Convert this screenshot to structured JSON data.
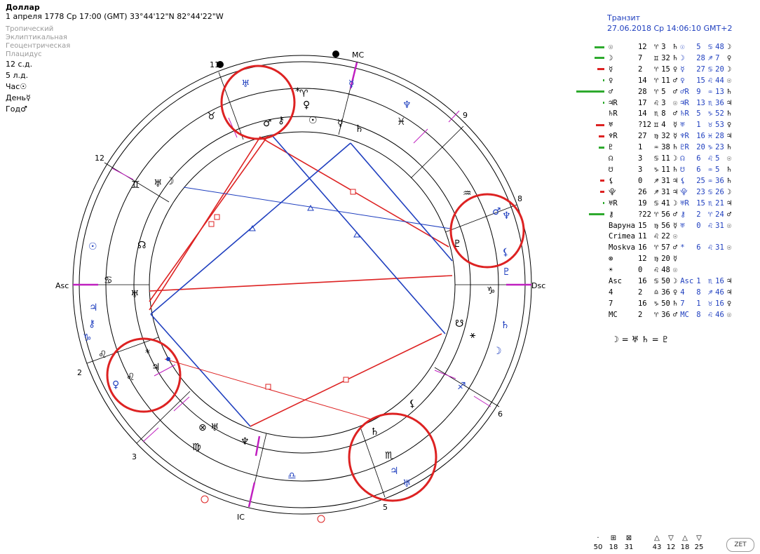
{
  "header": {
    "title": "Доллар",
    "subtitle": "1 апреля 1778  Ср  17:00 (GMT) 33°44'12\"N  82°44'22\"W",
    "settings": [
      "Тропический",
      "Эклиптикальная",
      "Геоцентрическая",
      "Плацидус"
    ],
    "day_info": [
      "12 с.д.",
      "5 л.д.",
      "Час☉",
      "День☿",
      "Год♂"
    ]
  },
  "transit": {
    "title": "Транзит",
    "datetime": "27.06.2018 Ср 14:06:10 GMT+2"
  },
  "wheel_labels": {
    "mc": "MC",
    "ic": "IC",
    "asc": "Asc",
    "dsc": "Dsc",
    "houses": [
      "11",
      "12",
      "2",
      "3",
      "5",
      "6",
      "8",
      "9"
    ]
  },
  "aspect_rows": [
    {
      "bar": "#2eaa2e",
      "w": 14,
      "n": "☉",
      "deg": "12",
      "sign": "♈",
      "min": "3",
      "r": "♄",
      "tn": "☉",
      "tdeg": "5",
      "tsign": "♋",
      "tmin": "48",
      "tr": "☽"
    },
    {
      "bar": "#2eaa2e",
      "w": 14,
      "n": "☽",
      "deg": "7",
      "sign": "♊",
      "min": "32",
      "r": "♄",
      "tn": "☽",
      "tdeg": "28",
      "tsign": "♐",
      "tmin": "7",
      "tr": "♀"
    },
    {
      "bar": "#dd2222",
      "w": 10,
      "n": "☿",
      "deg": "2",
      "sign": "♈",
      "min": "15",
      "r": "♀",
      "tn": "☿",
      "tdeg": "27",
      "tsign": "♋",
      "tmin": "20",
      "tr": "☽"
    },
    {
      "bar": "#2eaa2e",
      "w": 2,
      "n": "♀",
      "deg": "14",
      "sign": "♈",
      "min": "11",
      "r": "♂",
      "tn": "♀",
      "tdeg": "15",
      "tsign": "♌",
      "tmin": "44",
      "tr": "☉"
    },
    {
      "bar": "#2eaa2e",
      "w": 40,
      "n": "♂",
      "deg": "28",
      "sign": "♈",
      "min": "5",
      "r": "♂",
      "tn": "♂R",
      "tdeg": "9",
      "tsign": "♒",
      "tmin": "13",
      "tr": "♄"
    },
    {
      "bar": "#2eaa2e",
      "w": 2,
      "n": "♃R",
      "deg": "17",
      "sign": "♌",
      "min": "3",
      "r": "☉",
      "tn": "♃R",
      "tdeg": "13",
      "tsign": "♏",
      "tmin": "36",
      "tr": "♃"
    },
    {
      "bar": "",
      "w": 0,
      "n": "♄R",
      "deg": "14",
      "sign": "♏",
      "min": "8",
      "r": "♂",
      "tn": "♄R",
      "tdeg": "5",
      "tsign": "♑",
      "tmin": "52",
      "tr": "♄"
    },
    {
      "bar": "#dd2222",
      "w": 12,
      "n": "♅",
      "deg": "?12",
      "sign": "♊",
      "min": "4",
      "r": "☿",
      "tn": "♅",
      "tdeg": "1",
      "tsign": "♉",
      "tmin": "53",
      "tr": "♀"
    },
    {
      "bar": "#dd2222",
      "w": 8,
      "n": "♆R",
      "deg": "27",
      "sign": "♍",
      "min": "32",
      "r": "☿",
      "tn": "♆R",
      "tdeg": "16",
      "tsign": "♓",
      "tmin": "28",
      "tr": "♃"
    },
    {
      "bar": "#2eaa2e",
      "w": 8,
      "n": "♇",
      "deg": "1",
      "sign": "♒",
      "min": "38",
      "r": "♄",
      "tn": "♇R",
      "tdeg": "20",
      "tsign": "♑",
      "tmin": "23",
      "tr": "♄"
    },
    {
      "bar": "",
      "w": 0,
      "n": "☊",
      "deg": "3",
      "sign": "♋",
      "min": "11",
      "r": "☽",
      "tn": "☊",
      "tdeg": "6",
      "tsign": "♌",
      "tmin": "5",
      "tr": "☉"
    },
    {
      "bar": "",
      "w": 0,
      "n": "☋",
      "deg": "3",
      "sign": "♑",
      "min": "11",
      "r": "♄",
      "tn": "☋",
      "tdeg": "6",
      "tsign": "♒",
      "tmin": "5",
      "tr": "♄"
    },
    {
      "bar": "#dd2222",
      "w": 6,
      "n": "⚸",
      "deg": "0",
      "sign": "♐",
      "min": "31",
      "r": "♃",
      "tn": "⚸",
      "tdeg": "25",
      "tsign": "♒",
      "tmin": "36",
      "tr": "♄"
    },
    {
      "bar": "#dd2222",
      "w": 6,
      "n": "⯓",
      "deg": "26",
      "sign": "♐",
      "min": "31",
      "r": "♃",
      "tn": "⯓",
      "tdeg": "23",
      "tsign": "♋",
      "tmin": "26",
      "tr": "☽"
    },
    {
      "bar": "#2eaa2e",
      "w": 2,
      "n": "♅R",
      "deg": "19",
      "sign": "♋",
      "min": "41",
      "r": "☽",
      "tn": "♅R",
      "tdeg": "15",
      "tsign": "♏",
      "tmin": "21",
      "tr": "♃"
    },
    {
      "bar": "#2eaa2e",
      "w": 22,
      "n": "⚷",
      "deg": "?22",
      "sign": "♈",
      "min": "56",
      "r": "♂",
      "tn": "⚷",
      "tdeg": "2",
      "tsign": "♈",
      "tmin": "24",
      "tr": "♂"
    },
    {
      "bar": "",
      "w": 0,
      "n": "Варуна",
      "deg": "15",
      "sign": "♍",
      "min": "56",
      "r": "☿",
      "tn": "♅",
      "tdeg": "0",
      "tsign": "♌",
      "tmin": "31",
      "tr": "☉"
    },
    {
      "bar": "",
      "w": 0,
      "n": "Crimea",
      "deg": "11",
      "sign": "♌",
      "min": "22",
      "r": "☉",
      "tn": "",
      "tdeg": "",
      "tsign": "",
      "tmin": "",
      "tr": ""
    },
    {
      "bar": "",
      "w": 0,
      "n": "Moskva",
      "deg": "16",
      "sign": "♈",
      "min": "57",
      "r": "♂",
      "tn": "*",
      "tdeg": "6",
      "tsign": "♌",
      "tmin": "31",
      "tr": "☉"
    },
    {
      "bar": "",
      "w": 0,
      "n": "⊗",
      "deg": "12",
      "sign": "♍",
      "min": "20",
      "r": "☿",
      "tn": "",
      "tdeg": "",
      "tsign": "",
      "tmin": "",
      "tr": ""
    },
    {
      "bar": "",
      "w": 0,
      "n": "☀",
      "deg": "0",
      "sign": "♌",
      "min": "48",
      "r": "☉",
      "tn": "",
      "tdeg": "",
      "tsign": "",
      "tmin": "",
      "tr": ""
    },
    {
      "bar": "",
      "w": 0,
      "n": "Asc",
      "deg": "16",
      "sign": "♋",
      "min": "50",
      "r": "☽",
      "tn": "Asc",
      "tdeg": "1",
      "tsign": "♏",
      "tmin": "16",
      "tr": "♃"
    },
    {
      "bar": "",
      "w": 0,
      "n": "4",
      "deg": "2",
      "sign": "♎",
      "min": "36",
      "r": "♀",
      "tn": "4",
      "tdeg": "8",
      "tsign": "♐",
      "tmin": "46",
      "tr": "♃"
    },
    {
      "bar": "",
      "w": 0,
      "n": "7",
      "deg": "16",
      "sign": "♑",
      "min": "50",
      "r": "♄",
      "tn": "7",
      "tdeg": "1",
      "tsign": "♉",
      "tmin": "16",
      "tr": "♀"
    },
    {
      "bar": "",
      "w": 0,
      "n": "MC",
      "deg": "2",
      "sign": "♈",
      "min": "36",
      "r": "♂",
      "tn": "MC",
      "tdeg": "8",
      "tsign": "♌",
      "tmin": "46",
      "tr": "☉"
    }
  ],
  "formula": "☽ = ♅ ♄ = ♇",
  "bottom_stats": {
    "icons": [
      "·",
      "⊞",
      "⊠",
      "△",
      "▽",
      "△",
      "▽"
    ],
    "values": [
      "50",
      "18",
      "31",
      "43",
      "12",
      "18",
      "25"
    ]
  },
  "zet_label": "ZET",
  "colors": {
    "natal": "#000000",
    "transit": "#1f3fbf",
    "square": "#dd2222",
    "trine": "#1f3fbf",
    "cusp": "#c020c0",
    "circle": "#dd2222"
  }
}
